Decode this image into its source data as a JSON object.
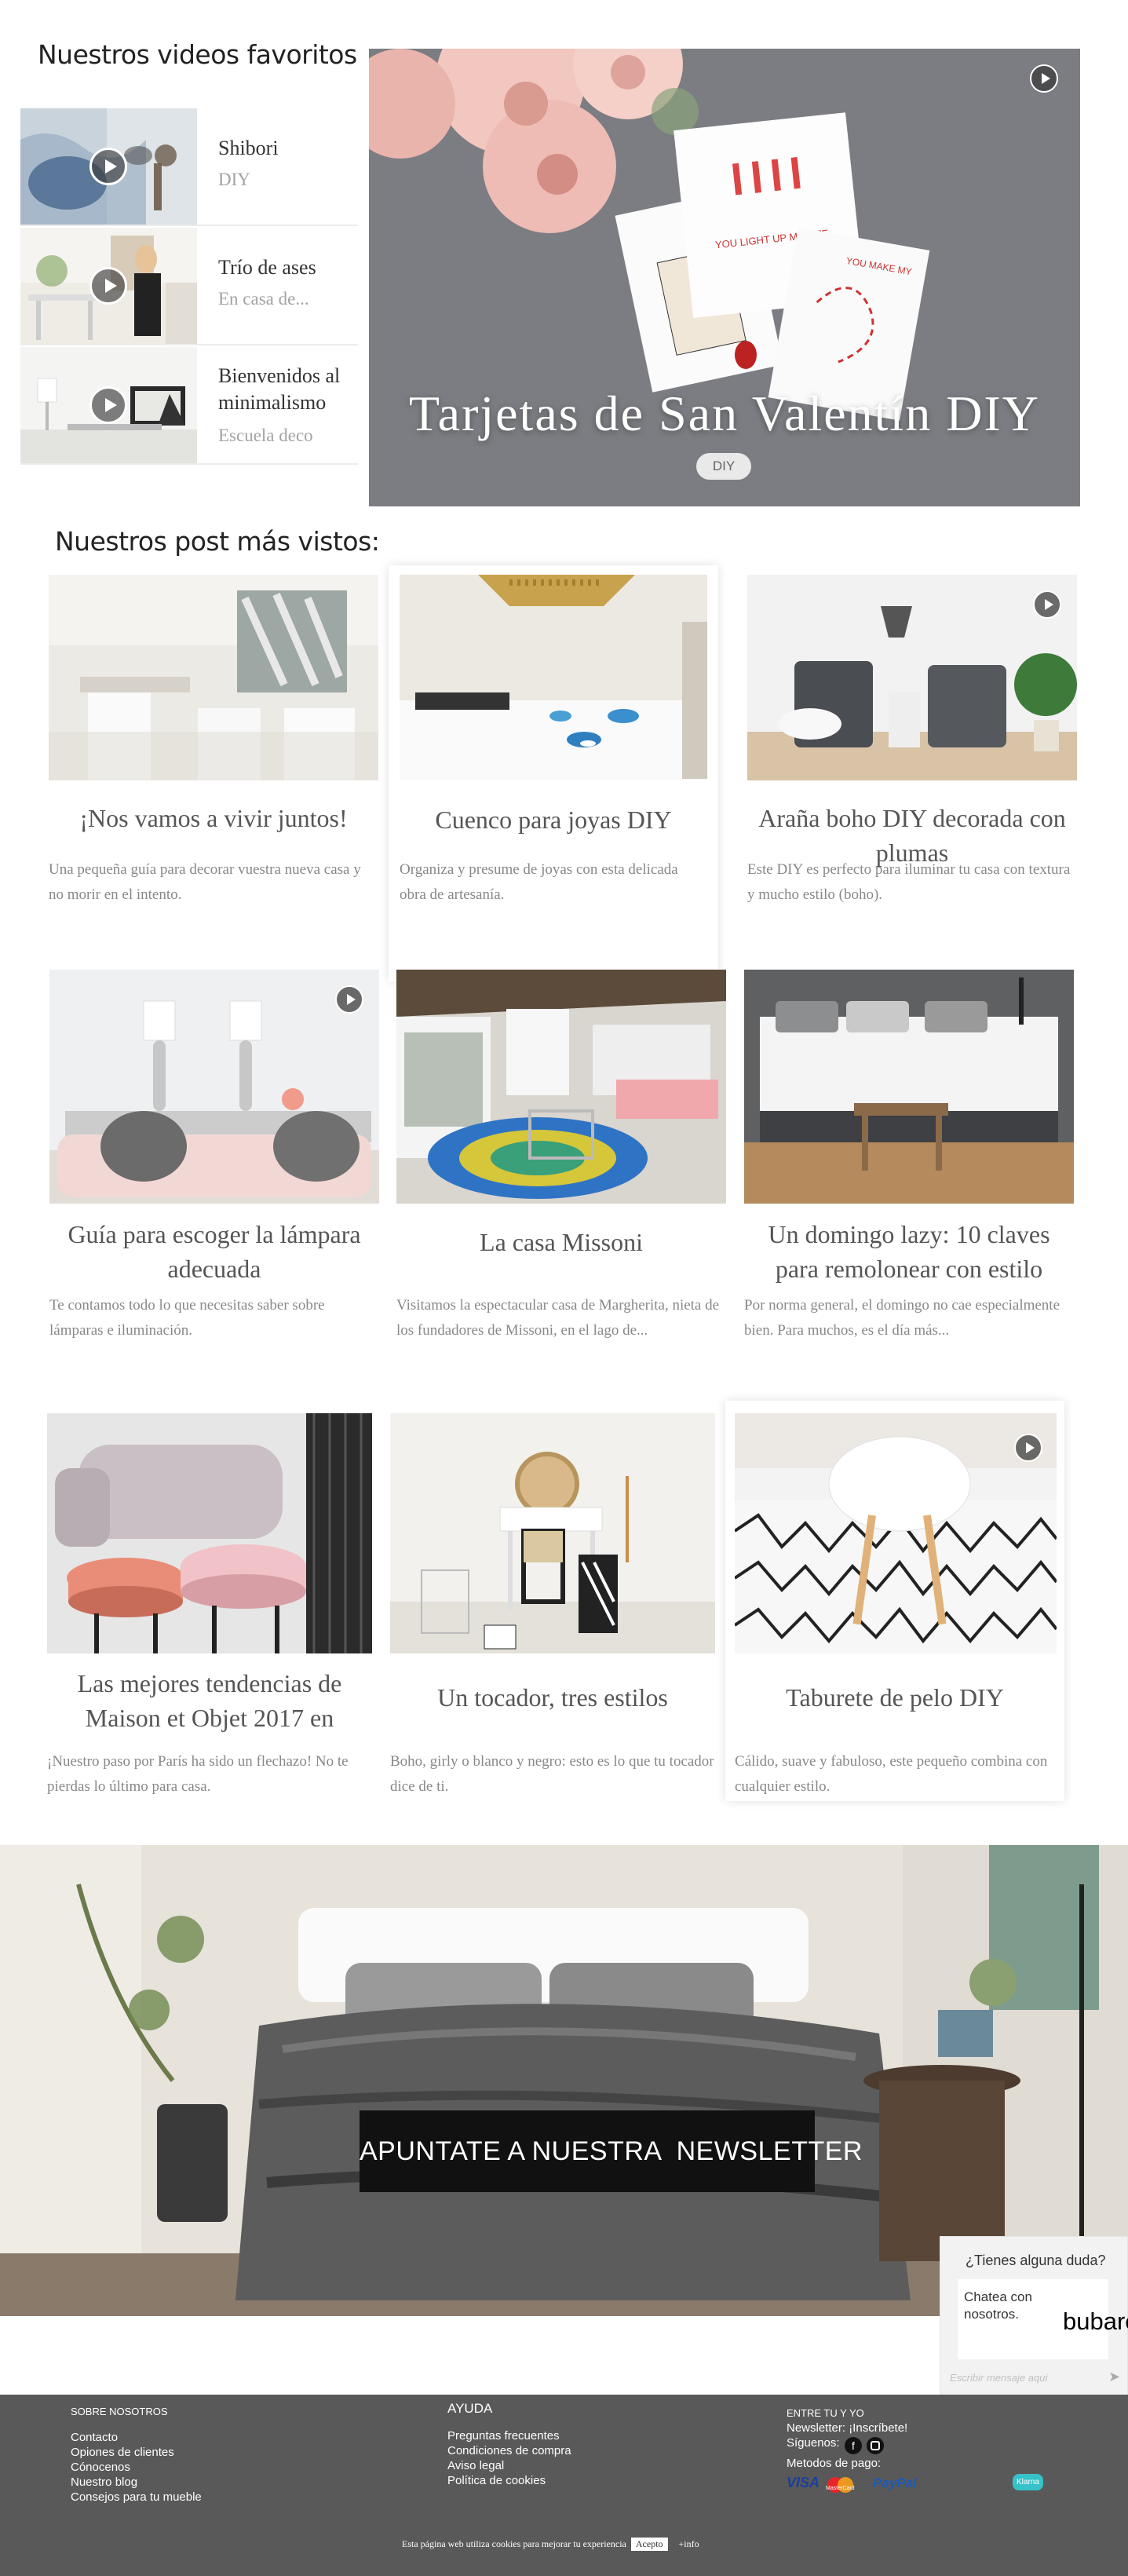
{
  "videos": {
    "title": "Nuestros videos favoritos",
    "items": [
      {
        "title": "Shibori",
        "subtitle": "DIY"
      },
      {
        "title": "Trío de ases",
        "subtitle": "En casa de..."
      },
      {
        "title": "Bienvenidos al minimalismo",
        "subtitle": "Escuela deco"
      }
    ],
    "featured": {
      "title": "Tarjetas de San Valentín DIY",
      "tag": "DIY"
    }
  },
  "posts": {
    "title": "Nuestros post más vistos:",
    "cards": [
      {
        "title": "¡Nos vamos a vivir juntos!",
        "desc": "Una pequeña guía para decorar vuestra nueva casa y no morir en el intento."
      },
      {
        "title": "Cuenco para joyas DIY",
        "desc": "Organiza y presume de joyas con esta delicada obra de artesanía."
      },
      {
        "title": "Araña boho DIY decorada con plumas",
        "desc": "Este DIY es perfecto para iluminar tu casa con textura y mucho estilo (boho)."
      },
      {
        "title": "Guía para escoger la lámpara adecuada",
        "desc": "Te contamos todo lo que necesitas saber sobre lámparas e iluminación."
      },
      {
        "title": "La casa Missoni",
        "desc": "Visitamos la espectacular casa de Margherita, nieta de los fundadores de Missoni, en el lago de..."
      },
      {
        "title": "Un domingo lazy: 10 claves para remolonear con estilo",
        "desc": "Por norma general, el domingo no cae especialmente bien. Para muchos, es el día más..."
      },
      {
        "title": "Las mejores tendencias de Maison et Objet 2017 en",
        "desc": "¡Nuestro paso por París ha sido un flechazo! No te pierdas lo último para casa."
      },
      {
        "title": "Un tocador, tres estilos",
        "desc": "Boho, girly o blanco y negro: esto es lo que tu tocador dice de ti."
      },
      {
        "title": "Taburete de pelo DIY",
        "desc": "Cálido, suave y fabuloso, este pequeño combina con cualquier estilo."
      }
    ]
  },
  "newsletter": {
    "button": "APUNTATE A NUESTRA  NEWSLETTER"
  },
  "chat": {
    "question": "¿Tienes alguna duda?",
    "body": "Chatea con nosotros.",
    "logo": "bubare",
    "placeholder": "Escribir mensaje aquí"
  },
  "footer": {
    "about": {
      "heading": "SOBRE NOSOTROS",
      "links": [
        "Contacto",
        "Opiones de clientes",
        "Cónocenos",
        "Nuestro blog",
        "Consejos para tu mueble"
      ]
    },
    "help": {
      "heading": "AYUDA",
      "links": [
        "Preguntas frecuentes",
        "Condiciones de compra",
        "Aviso legal",
        "Política de cookies"
      ]
    },
    "social": {
      "heading": "ENTRE TU Y YO",
      "newsletter": "Newsletter: ¡Inscríbete!",
      "follow": "Síguenos:",
      "payment": "Metodos de pago:",
      "payment_logos": [
        "VISA",
        "MasterCard",
        "PayPal",
        "Klarna"
      ]
    },
    "cookie": {
      "text": "Esta página web utiliza cookies para mejorar tu experiencia",
      "accept": "Acepto",
      "more": "+info"
    }
  },
  "colors": {
    "footer": "#595959",
    "newsletter_button": "#111111",
    "accent_text": "#555555"
  }
}
